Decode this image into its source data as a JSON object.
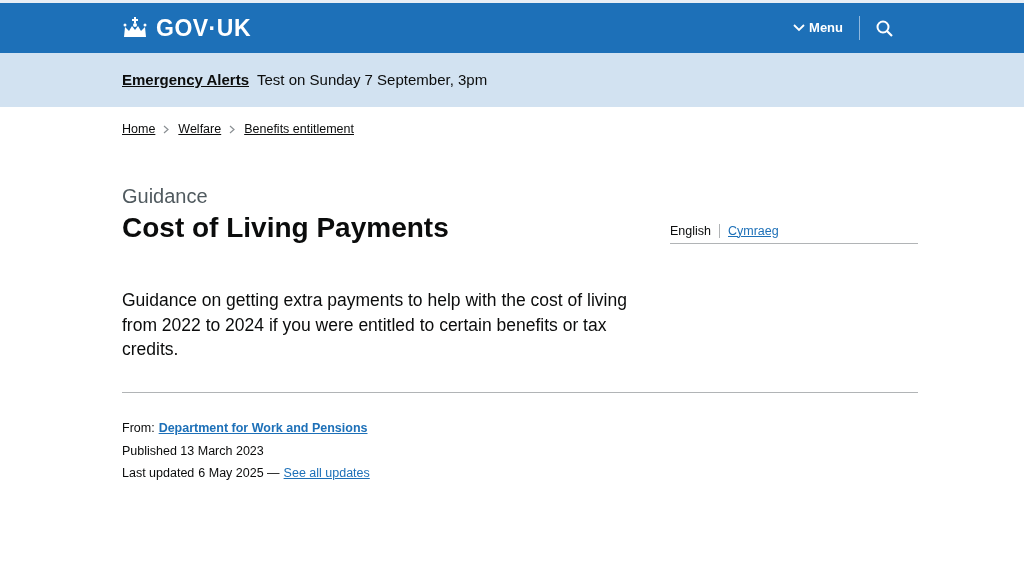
{
  "header": {
    "logo": "GOV·UK",
    "menu_label": "Menu"
  },
  "alert": {
    "title": "Emergency Alerts",
    "text": "Test on Sunday 7 September, 3pm"
  },
  "breadcrumbs": [
    "Home",
    "Welfare",
    "Benefits entitlement"
  ],
  "caption": "Guidance",
  "title": "Cost of Living Payments",
  "languages": [
    {
      "label": "English",
      "selected": true
    },
    {
      "label": "Cymraeg",
      "selected": false
    }
  ],
  "summary": "Guidance on getting extra payments to help with the cost of living from 2022 to 2024 if you were entitled to certain benefits or tax credits.",
  "metadata": {
    "from_label": "From:",
    "from_link": "Department for Work and Pensions",
    "published": "Published 13 March 2023",
    "updated_label": "Last updated",
    "updated_date": "6 May 2025 —",
    "updates_link": "See all updates"
  }
}
